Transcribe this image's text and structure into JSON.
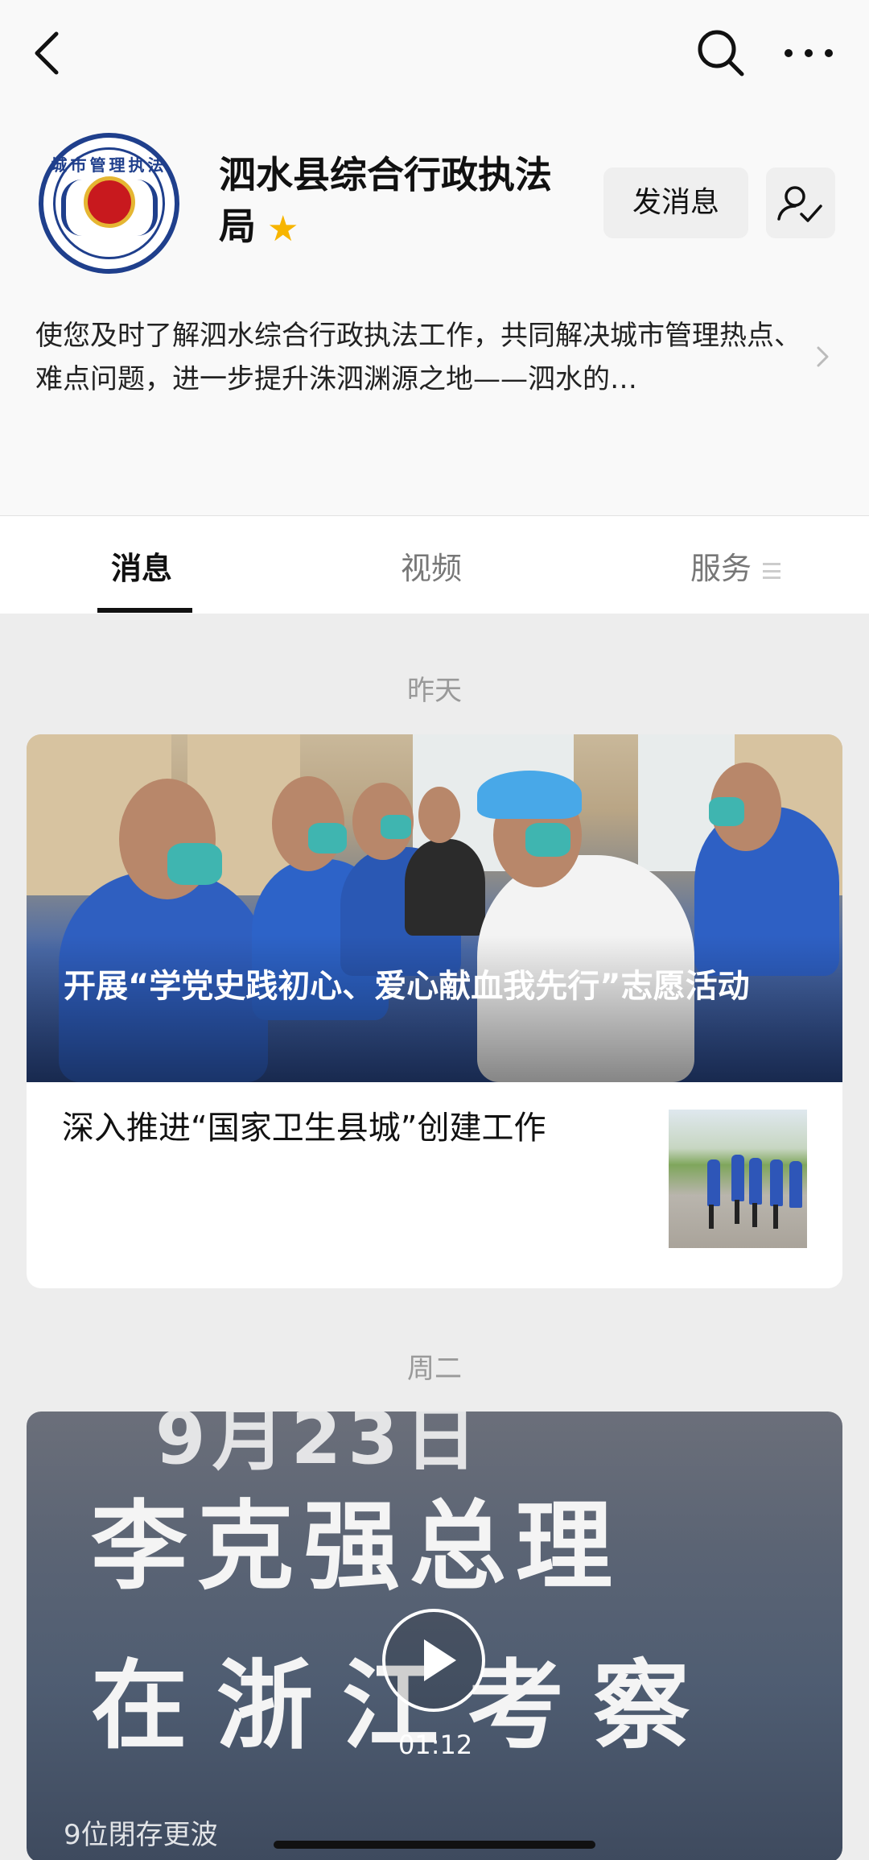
{
  "header": {
    "back_icon": "chevron-left-icon",
    "search_icon": "search-icon",
    "more_icon": "more-horizontal-icon"
  },
  "account": {
    "logo_text": "城市管理执法",
    "name": "泗水县综合行政执法局",
    "star_icon": "star-icon",
    "star_color": "#f7b500",
    "message_button": "发消息",
    "follow_icon": "user-check-icon",
    "description": "使您及时了解泗水综合行政执法工作，共同解决城市管理热点、难点问题，进一步提升洙泗渊源之地——泗水的…"
  },
  "tabs": [
    {
      "label": "消息",
      "active": true
    },
    {
      "label": "视频",
      "active": false
    },
    {
      "label": "服务",
      "active": false
    }
  ],
  "feed": {
    "groups": [
      {
        "date": "昨天",
        "articles": [
          {
            "title": "开展“学党史践初心、爱心献血我先行”志愿活动",
            "kind": "hero"
          },
          {
            "title": "深入推进“国家卫生县城”创建工作",
            "kind": "thumbnail"
          }
        ]
      },
      {
        "date": "周二",
        "video": {
          "overlay_line_top": "9月23日",
          "overlay_line_1": "李克强总理",
          "overlay_line_2": "在浙江考察",
          "duration": "01:12",
          "caption": "9位閉存更波"
        }
      }
    ]
  }
}
